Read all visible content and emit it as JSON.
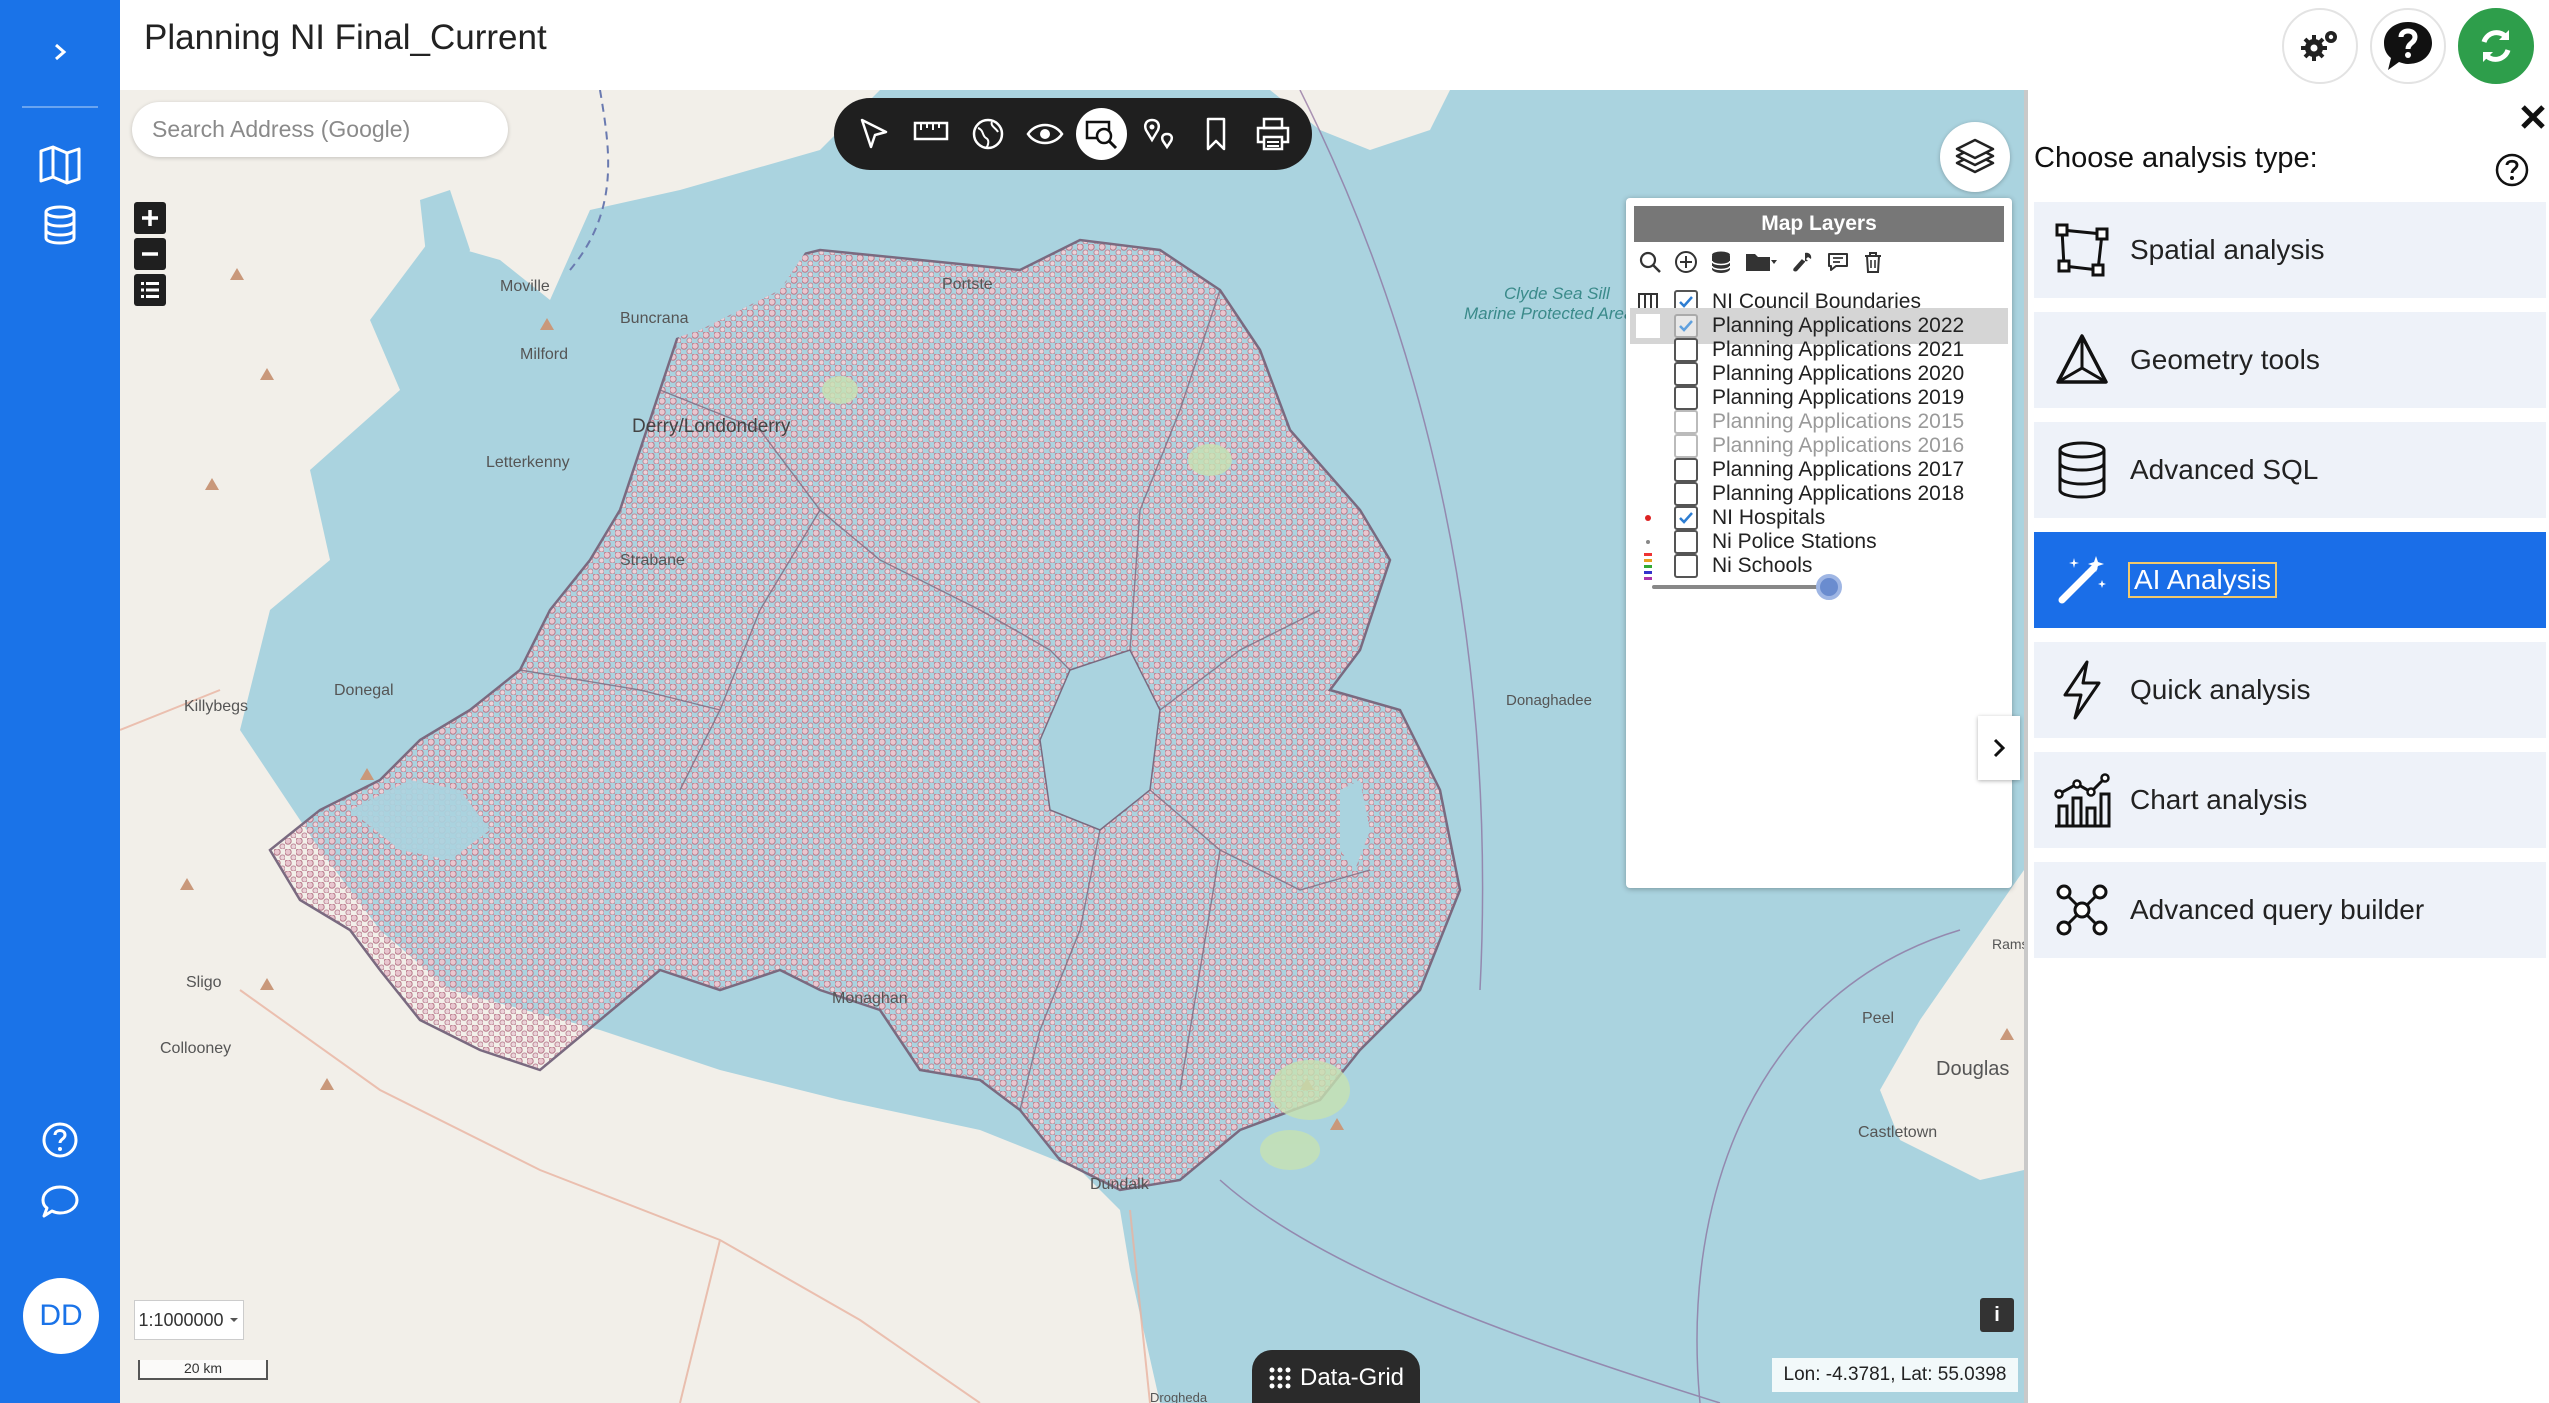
{
  "app": {
    "title": "Planning NI Final_Current"
  },
  "sidebar": {
    "avatar_initials": "DD"
  },
  "map": {
    "search_placeholder": "Search Address (Google)",
    "scale_select": "1:1000000",
    "scale_bar_label": "20 km",
    "data_grid_label": "Data-Grid",
    "coordinates": "Lon: -4.3781, Lat: 55.0398",
    "place_labels": [
      "Moville",
      "Portste",
      "Buncrana",
      "Milford",
      "Derry/Londonderry",
      "Letterkenny",
      "Strabane",
      "Killybegs",
      "Donegal",
      "Sligo",
      "Collooney",
      "Monaghan",
      "Dundalk",
      "Drogheda",
      "Douglas",
      "Peel",
      "Castletown",
      "Ramsey",
      "Donaghadee",
      "Clyde Sea Sill",
      "Marine Protected Area"
    ]
  },
  "layers_panel": {
    "title": "Map Layers",
    "layers": [
      {
        "label": "NI Council Boundaries",
        "checked": true,
        "dim": false
      },
      {
        "label": "Planning Applications 2022",
        "checked": true,
        "dim": false
      },
      {
        "label": "Planning Applications 2021",
        "checked": false,
        "dim": false
      },
      {
        "label": "Planning Applications 2020",
        "checked": false,
        "dim": false
      },
      {
        "label": "Planning Applications 2019",
        "checked": false,
        "dim": false
      },
      {
        "label": "Planning Applications 2015",
        "checked": false,
        "dim": true
      },
      {
        "label": "Planning Applications 2016",
        "checked": false,
        "dim": true
      },
      {
        "label": "Planning Applications 2017",
        "checked": false,
        "dim": false
      },
      {
        "label": "Planning Applications 2018",
        "checked": false,
        "dim": false
      },
      {
        "label": "NI Hospitals",
        "checked": true,
        "dim": false
      },
      {
        "label": "Ni Police Stations",
        "checked": false,
        "dim": false
      },
      {
        "label": "Ni Schools",
        "checked": false,
        "dim": false
      }
    ]
  },
  "analysis": {
    "title": "Choose analysis type:",
    "items": [
      {
        "label": "Spatial analysis",
        "icon": "polygon-icon"
      },
      {
        "label": "Geometry tools",
        "icon": "triangle-icon"
      },
      {
        "label": "Advanced SQL",
        "icon": "database-icon"
      },
      {
        "label": "AI Analysis",
        "icon": "magic-wand-icon"
      },
      {
        "label": "Quick analysis",
        "icon": "lightning-icon"
      },
      {
        "label": "Chart analysis",
        "icon": "chart-icon"
      },
      {
        "label": "Advanced query builder",
        "icon": "network-icon"
      }
    ]
  },
  "colors": {
    "brand": "#1a73e8",
    "active_item": "#1a6ee8",
    "sea": "#aad3df",
    "land": "#f2efe9",
    "points": "#c88a9a"
  }
}
